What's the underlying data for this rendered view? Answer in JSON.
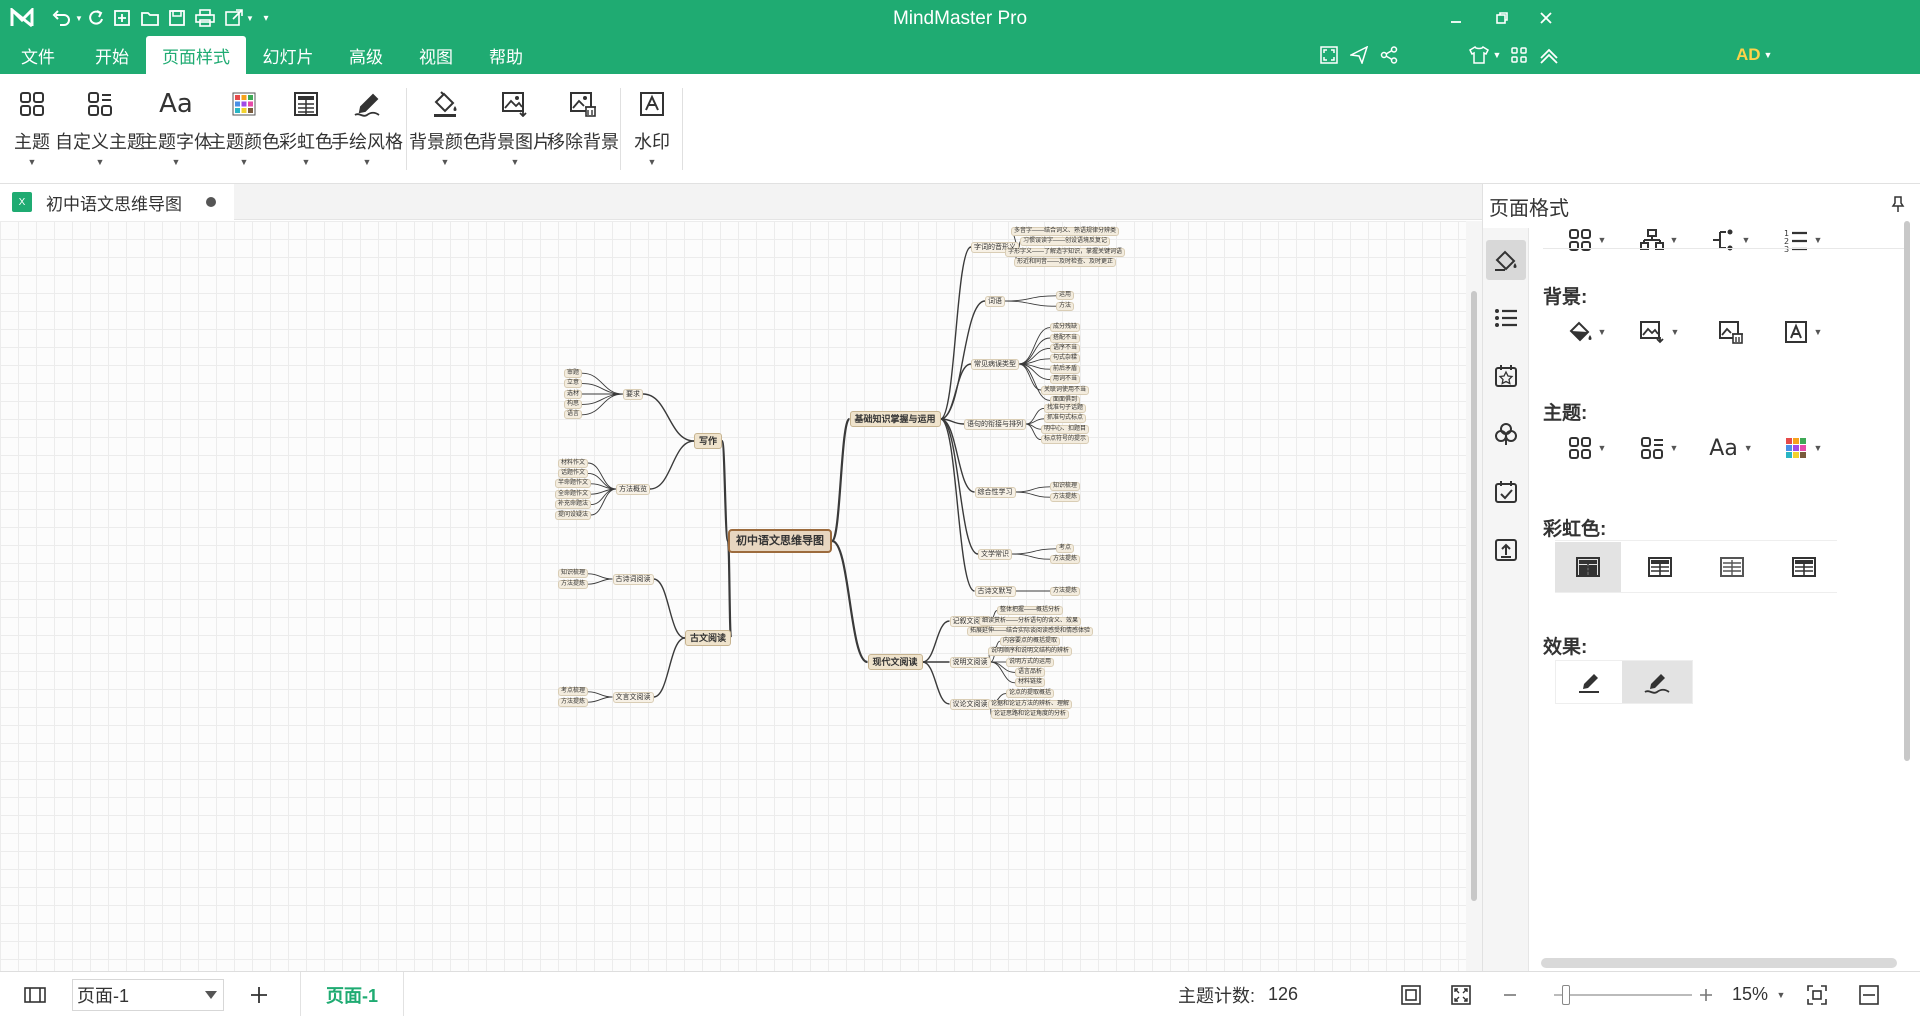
{
  "app": {
    "title": "MindMaster Pro"
  },
  "menu": [
    {
      "label": "文件"
    },
    {
      "label": "开始"
    },
    {
      "label": "页面样式",
      "active": true
    },
    {
      "label": "幻灯片"
    },
    {
      "label": "高级"
    },
    {
      "label": "视图"
    },
    {
      "label": "帮助"
    }
  ],
  "account": {
    "initials": "AD"
  },
  "ribbon": {
    "theme": "主题",
    "custom_theme": "自定义主题",
    "theme_font": "主题字体",
    "theme_color": "主题颜色",
    "rainbow": "彩虹色",
    "hand_drawn": "手绘风格",
    "bg_color": "背景颜色",
    "bg_image": "背景图片",
    "remove_bg": "移除背景",
    "watermark": "水印"
  },
  "document": {
    "tab_name": "初中语文思维导图",
    "unsaved": true
  },
  "panel": {
    "title": "页面格式",
    "background_label": "背景:",
    "theme_label": "主题:",
    "rainbow_label": "彩虹色:",
    "effect_label": "效果:"
  },
  "status": {
    "page_select": "页面-1",
    "page_tab": "页面-1",
    "topic_count_label": "主题计数:",
    "topic_count": "126",
    "zoom": "15%"
  },
  "colors": {
    "brand": "#1fab72",
    "ad_badge": "#ffd24a"
  },
  "mindmap": {
    "root": "初中语文思维导图",
    "branches": [
      {
        "label": "写作",
        "children": [
          {
            "label": "要求",
            "children": [
              "审题",
              "立意",
              "选材",
              "构思",
              "语言"
            ]
          },
          {
            "label": "方法概览",
            "children": [
              "材料作文",
              "话题作文",
              "半命题作文",
              "全命题作文",
              "补充命题法",
              "提问设疑法"
            ]
          }
        ]
      },
      {
        "label": "古文阅读",
        "children": [
          {
            "label": "古诗词阅读",
            "children": [
              "知识梳理",
              "方法提炼"
            ]
          },
          {
            "label": "文言文阅读",
            "children": [
              "考点梳理",
              "方法提炼"
            ]
          }
        ]
      },
      {
        "label": "基础知识掌握与运用",
        "children": [
          {
            "label": "字词的音形义",
            "children": [
              "多音字——结合词义、熟语规律分辨类",
              "习惯误读字——创设语境反复记",
              "字形字义——了解造字知识，掌握关键词语",
              "形近和同音——及时检查、及时更正"
            ]
          },
          {
            "label": "词语",
            "children": [
              "运用",
              "方法"
            ]
          },
          {
            "label": "常见病误类型",
            "children": [
              "成分残缺",
              "搭配不当",
              "语序不当",
              "句式杂糅",
              "前后矛盾",
              "用词不当",
              "关联词使用不当",
              "面面俱到"
            ]
          },
          {
            "label": "语句的衔接与排列",
            "children": [
              "找准句子话题",
              "抓准句式标点",
              "明中心、扣题目",
              "标点符号的提示"
            ]
          },
          {
            "label": "综合性学习",
            "children": [
              "知识梳理",
              "方法提炼"
            ]
          },
          {
            "label": "文学常识",
            "children": [
              "考点",
              "方法提炼"
            ]
          },
          {
            "label": "古诗文默写",
            "children": [
              "方法提炼"
            ]
          }
        ]
      },
      {
        "label": "现代文阅读",
        "children": [
          {
            "label": "记叙文阅读",
            "children": [
              "整体把握——概括分析",
              "细读赏析——分析语句的含义、效果",
              "拓展延伸——结合实际谈阅读感受和情感体验"
            ]
          },
          {
            "label": "说明文阅读",
            "children": [
              "内容要点的概括提取",
              "说明顺序和说明文结构的辨析",
              "说明方式的运用",
              "语言品析",
              "材料链接"
            ]
          },
          {
            "label": "议论文阅读",
            "children": [
              "论点的提取概括",
              "论据和论证方法的辨析、理解",
              "论证思路和论证角度的分析"
            ]
          }
        ]
      }
    ]
  }
}
